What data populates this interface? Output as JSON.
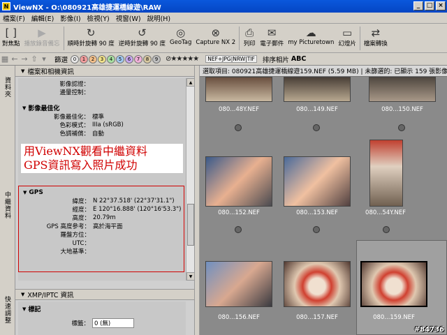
{
  "window": {
    "title": "ViewNX - O:\\080921高雄捷運橋線遊\\RAW",
    "app_icon": "N"
  },
  "menu": [
    "檔案(F)",
    "編輯(E)",
    "影像(I)",
    "檢視(Y)",
    "視窗(W)",
    "說明(H)"
  ],
  "toolbar": [
    {
      "label": "對焦點",
      "icon": "focus-point-icon",
      "glyph": "[ ]",
      "disabled": false
    },
    {
      "label": "播放錄音備忘",
      "icon": "play-memo-icon",
      "glyph": "▶",
      "disabled": true
    },
    {
      "label": "順時針旋轉 90 度",
      "icon": "rotate-cw-icon",
      "glyph": "↻",
      "disabled": false
    },
    {
      "label": "逆時針旋轉 90 度",
      "icon": "rotate-ccw-icon",
      "glyph": "↺",
      "disabled": false
    },
    {
      "label": "GeoTag",
      "icon": "geotag-icon",
      "glyph": "◎",
      "disabled": false
    },
    {
      "label": "Capture NX 2",
      "icon": "capture-nx-icon",
      "glyph": "⊗",
      "disabled": false
    },
    {
      "label": "列印",
      "icon": "print-icon",
      "glyph": "⎙",
      "disabled": false
    },
    {
      "label": "電子郵件",
      "icon": "email-icon",
      "glyph": "✉",
      "disabled": false
    },
    {
      "label": "my Picturetown",
      "icon": "picturetown-icon",
      "glyph": "☁",
      "disabled": false
    },
    {
      "label": "幻燈片",
      "icon": "slideshow-icon",
      "glyph": "▭",
      "disabled": false
    },
    {
      "label": "檔案轉換",
      "icon": "file-convert-icon",
      "glyph": "⇄",
      "disabled": false
    }
  ],
  "toolbar2": {
    "filter_label": "篩選",
    "numbers": [
      "0",
      "1",
      "2",
      "3",
      "4",
      "5",
      "6",
      "7",
      "8",
      "9"
    ],
    "stars": "⊘★★★★★",
    "format": "NEF+JPG|NRW|TIF",
    "sort_label": "排序相片",
    "sort_value": "ABC"
  },
  "left_tabs": {
    "tab1": "資料夾",
    "tab2": "中繼資料",
    "tab3": "快速調整"
  },
  "left_panel": {
    "header": "檔案和相機資訊",
    "pre_rows": [
      {
        "k": "影像認證：",
        "v": ""
      },
      {
        "k": "邊暈控制：",
        "v": ""
      }
    ],
    "optimize_section": "影像最佳化",
    "optimize_rows": [
      {
        "k": "影像最佳化：",
        "v": "標準"
      },
      {
        "k": "色彩模式：",
        "v": "IIIa (sRGB)"
      },
      {
        "k": "色調補償：",
        "v": "自動"
      }
    ],
    "overlay_line1": "用ViewNX觀看中繼資料",
    "overlay_line2": "GPS資訊寫入照片成功",
    "gps_section": "GPS",
    "gps_rows": [
      {
        "k": "緯度：",
        "v": "N 22°37.518' (22°37'31.1\")"
      },
      {
        "k": "經度：",
        "v": "E 120°16.888' (120°16'53.3\")"
      },
      {
        "k": "高度：",
        "v": "20.79m"
      },
      {
        "k": "GPS 高度參考：",
        "v": "高於海平面"
      },
      {
        "k": "羅盤方位：",
        "v": ""
      },
      {
        "k": "UTC：",
        "v": ""
      },
      {
        "k": "大地基準：",
        "v": ""
      }
    ],
    "xmp_header": "XMP/IPTC 資訊",
    "xmp_sub": "標記",
    "label_key": "標籤：",
    "label_value": "0 (無)"
  },
  "right_panel": {
    "status": "選取項目: 080921高雄捷運橋線遊159.NEF (5.59 MB) | 未篩選的: 已顯示 159 張影像",
    "thumbs": [
      {
        "label": "080...48Y.NEF"
      },
      {
        "label": "080...149.NEF"
      },
      {
        "label": "080...150.NEF"
      },
      {
        "label": "080...152.NEF"
      },
      {
        "label": "080...153.NEF"
      },
      {
        "label": "080...54Y.NEF"
      },
      {
        "label": "080...156.NEF"
      },
      {
        "label": "080...157.NEF"
      },
      {
        "label": "080...159.NEF"
      }
    ]
  },
  "watermark": "#84736"
}
